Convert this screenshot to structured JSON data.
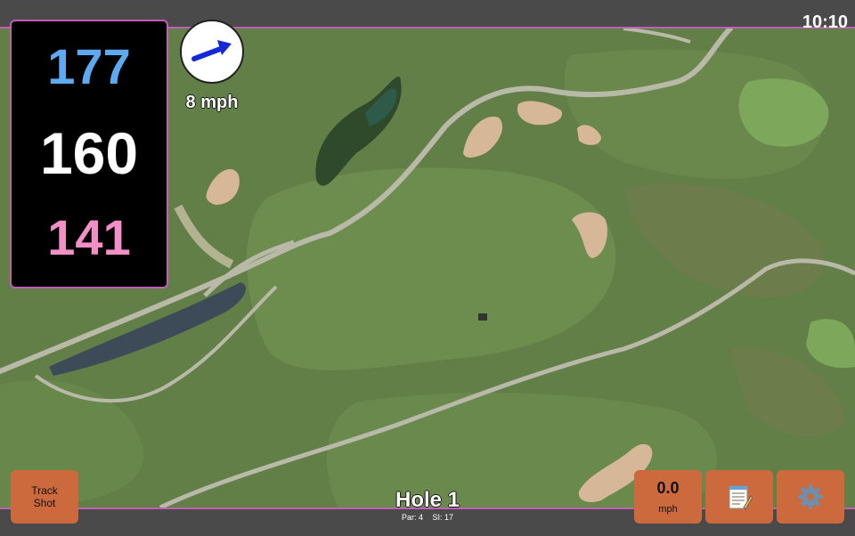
{
  "status": {
    "time": "10:10"
  },
  "distances": {
    "back": "177",
    "middle": "160",
    "front": "141"
  },
  "wind": {
    "speed": "8 mph",
    "direction_icon": "arrow-icon"
  },
  "buttons": {
    "track_shot_line1": "Track",
    "track_shot_line2": "Shot",
    "speed_value": "0.0",
    "speed_unit": "mph",
    "notes_icon": "notepad-icon",
    "settings_icon": "gear-icon"
  },
  "hole": {
    "title": "Hole 1",
    "par": "Par: 4",
    "si": "SI: 17"
  },
  "colors": {
    "accent": "#c05fb5",
    "back_distance": "#5daaf0",
    "middle_distance": "#ffffff",
    "front_distance": "#f38fc7",
    "button": "#cc6a3e"
  }
}
